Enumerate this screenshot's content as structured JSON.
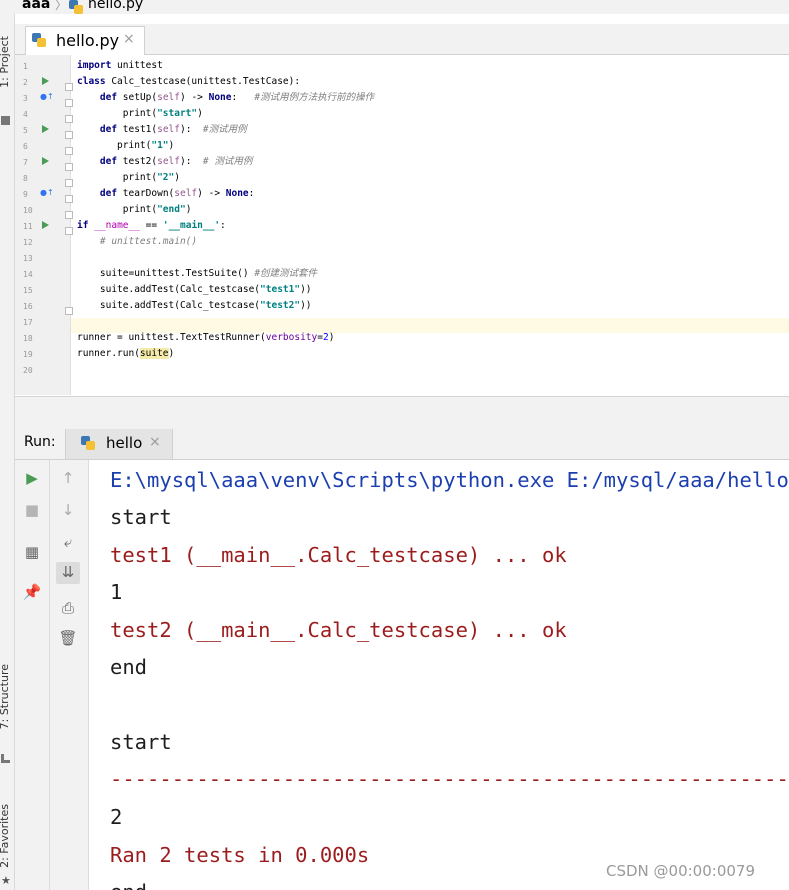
{
  "breadcrumb": {
    "project": "aaa",
    "file": "hello.py"
  },
  "left_strip": {
    "project_tab": "1: Project",
    "structure_tab": "7: Structure",
    "favorites_tab": "2: Favorites"
  },
  "editor_tab": {
    "label": "hello.py",
    "close": "×"
  },
  "editor": {
    "line_numbers": [
      "1",
      "2",
      "3",
      "4",
      "5",
      "6",
      "7",
      "8",
      "9",
      "10",
      "11",
      "12",
      "13",
      "14",
      "15",
      "16",
      "17",
      "18",
      "19",
      "20"
    ],
    "lines": [
      "import unittest",
      "class Calc_testcase(unittest.TestCase):",
      "    def setUp(self) -> None:   #测试用例方法执行前的操作",
      "        print(\"start\")",
      "    def test1(self):  #测试用例",
      "       print(\"1\")",
      "    def test2(self):  # 测试用例",
      "        print(\"2\")",
      "    def tearDown(self) -> None:",
      "        print(\"end\")",
      "if __name__ == '__main__':",
      "    # unittest.main()",
      "",
      "    suite=unittest.TestSuite() #创建测试套件",
      "    suite.addTest(Calc_testcase(\"test1\"))",
      "    suite.addTest(Calc_testcase(\"test2\"))",
      "",
      "runner = unittest.TextTestRunner(verbosity=2)",
      "runner.run(suite)",
      ""
    ]
  },
  "run_panel": {
    "label": "Run:",
    "tab_label": "hello",
    "close": "×"
  },
  "console": {
    "lines": [
      "E:\\mysql\\aaa\\venv\\Scripts\\python.exe E:/mysql/aaa/hello.py",
      "start",
      "test1 (__main__.Calc_testcase) ... ok",
      "1",
      "test2 (__main__.Calc_testcase) ... ok",
      "end",
      "",
      "start",
      "----------------------------------------------------------------------",
      "2",
      "Ran 2 tests in 0.000s",
      "end"
    ]
  },
  "watermark": "CSDN @00:00:0079",
  "colors": {
    "run_green": "#499c54",
    "console_blue": "#1c3fb0",
    "console_red": "#9b1c1c"
  }
}
